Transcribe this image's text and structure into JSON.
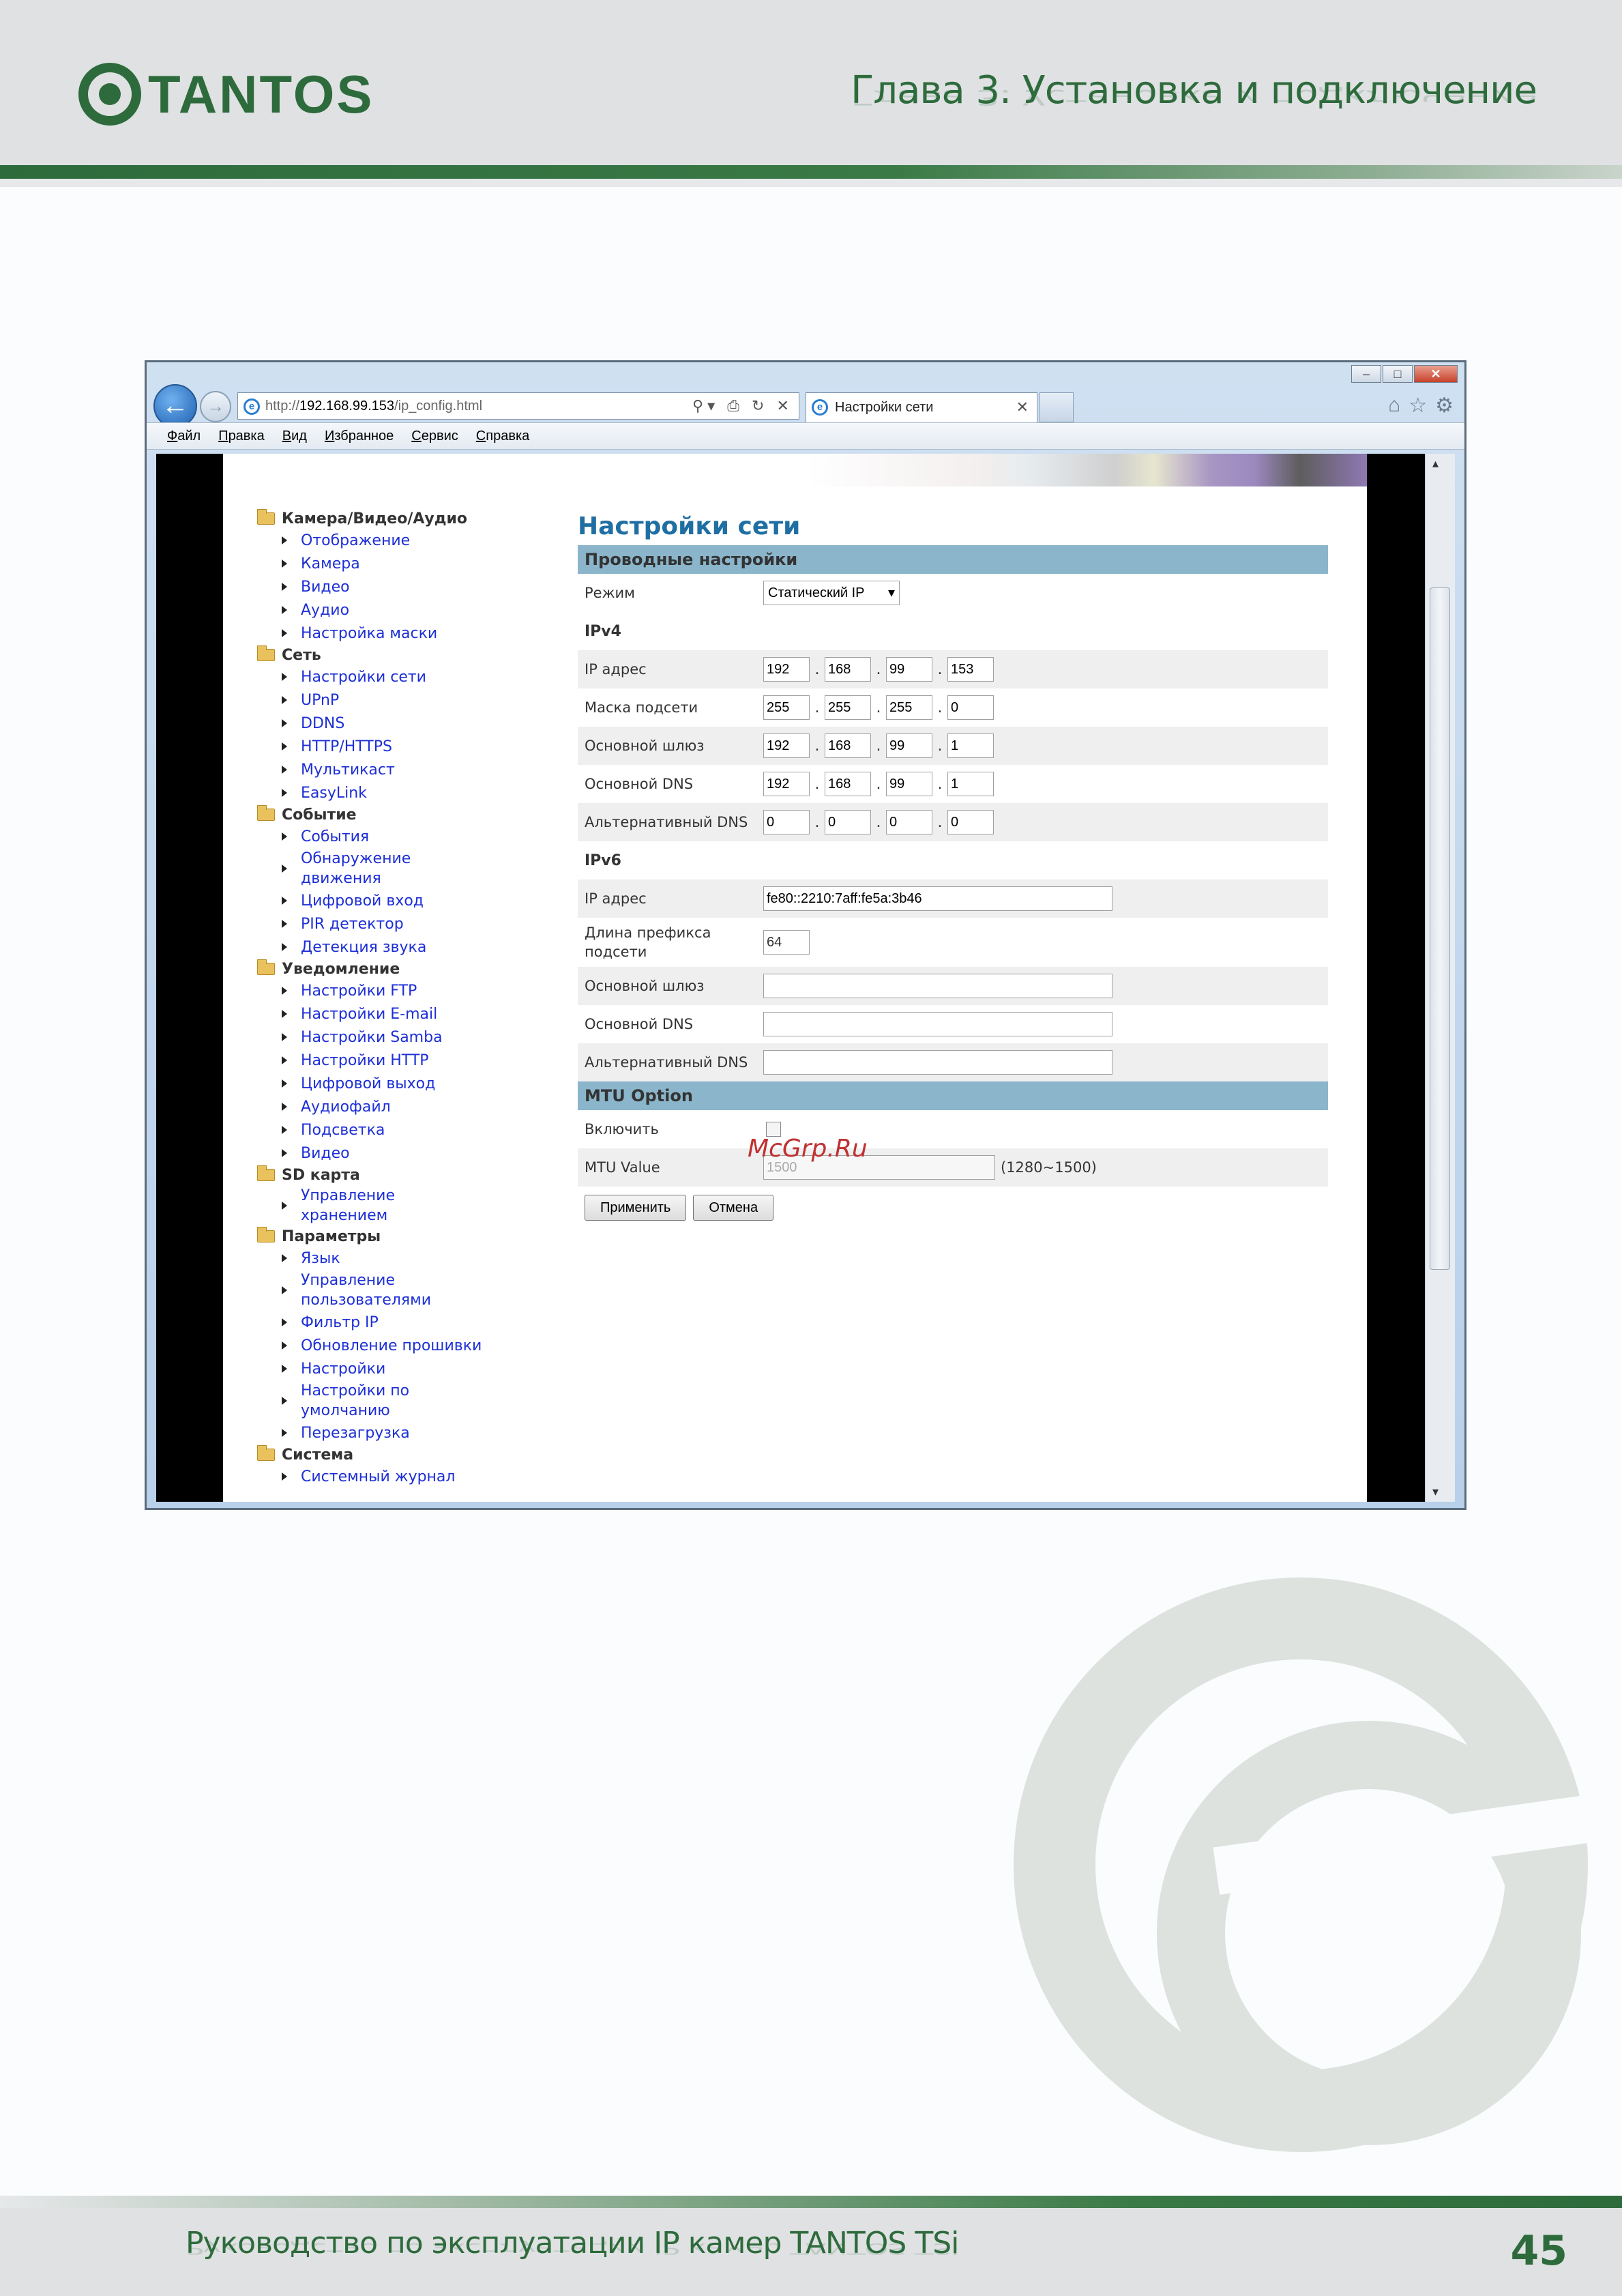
{
  "header": {
    "logo_text": "TANTOS",
    "chapter": "Глава 3. Установка и подключение"
  },
  "browser": {
    "url_prefix": "http://",
    "url_host": "192.168.99.153",
    "url_path": "/ip_config.html",
    "tab_title": "Настройки сети",
    "menu": [
      "Файл",
      "Правка",
      "Вид",
      "Избранное",
      "Сервис",
      "Справка"
    ]
  },
  "nav": [
    {
      "category": "Камера/Видео/Аудио",
      "items": [
        "Отображение",
        "Камера",
        "Видео",
        "Аудио",
        "Настройка маски"
      ]
    },
    {
      "category": "Сеть",
      "items": [
        "Настройки сети",
        "UPnP",
        "DDNS",
        "HTTP/HTTPS",
        "Мультикаст",
        "EasyLink"
      ]
    },
    {
      "category": "Событие",
      "items": [
        "События",
        "Обнаружение движения",
        "Цифровой вход",
        "PIR детектор",
        "Детекция звука"
      ]
    },
    {
      "category": "Уведомление",
      "items": [
        "Настройки FTP",
        "Настройки E-mail",
        "Настройки Samba",
        "Настройки HTTP",
        "Цифровой выход",
        "Аудиофайл",
        "Подсветка",
        "Видео"
      ]
    },
    {
      "category": "SD карта",
      "items": [
        "Управление хранением"
      ]
    },
    {
      "category": "Параметры",
      "items": [
        "Язык",
        "Управление пользователями",
        "Фильтр IP",
        "Обновление прошивки",
        "Настройки",
        "Настройки по умолчанию",
        "Перезагрузка"
      ]
    },
    {
      "category": "Система",
      "items": [
        "Системный журнал"
      ]
    }
  ],
  "content": {
    "title": "Настройки сети",
    "wired_section": "Проводные настройки",
    "mode_label": "Режим",
    "mode_value": "Статический IP",
    "ipv4_label": "IPv4",
    "ipv4_rows": [
      {
        "label": "IP адрес",
        "octets": [
          "192",
          "168",
          "99",
          "153"
        ]
      },
      {
        "label": "Маска подсети",
        "octets": [
          "255",
          "255",
          "255",
          "0"
        ]
      },
      {
        "label": "Основной шлюз",
        "octets": [
          "192",
          "168",
          "99",
          "1"
        ]
      },
      {
        "label": "Основной DNS",
        "octets": [
          "192",
          "168",
          "99",
          "1"
        ]
      },
      {
        "label": "Альтернативный DNS",
        "octets": [
          "0",
          "0",
          "0",
          "0"
        ]
      }
    ],
    "ipv6_label": "IPv6",
    "ipv6_address_label": "IP адрес",
    "ipv6_address_value": "fe80::2210:7aff:fe5a:3b46",
    "ipv6_prefix_label": "Длина префикса подсети",
    "ipv6_prefix_value": "64",
    "ipv6_gateway_label": "Основной шлюз",
    "ipv6_dns_label": "Основной DNS",
    "ipv6_alt_dns_label": "Альтернативный DNS",
    "mtu_section": "MTU Option",
    "mtu_enable_label": "Включить",
    "mtu_value_label": "MTU Value",
    "mtu_value_placeholder": "1500",
    "mtu_range": "(1280~1500)",
    "apply_label": "Применить",
    "cancel_label": "Отмена"
  },
  "watermark": "McGrp.Ru",
  "footer": {
    "text": "Руководство по эксплуатации IP камер TANTOS TSi",
    "page_number": "45"
  }
}
